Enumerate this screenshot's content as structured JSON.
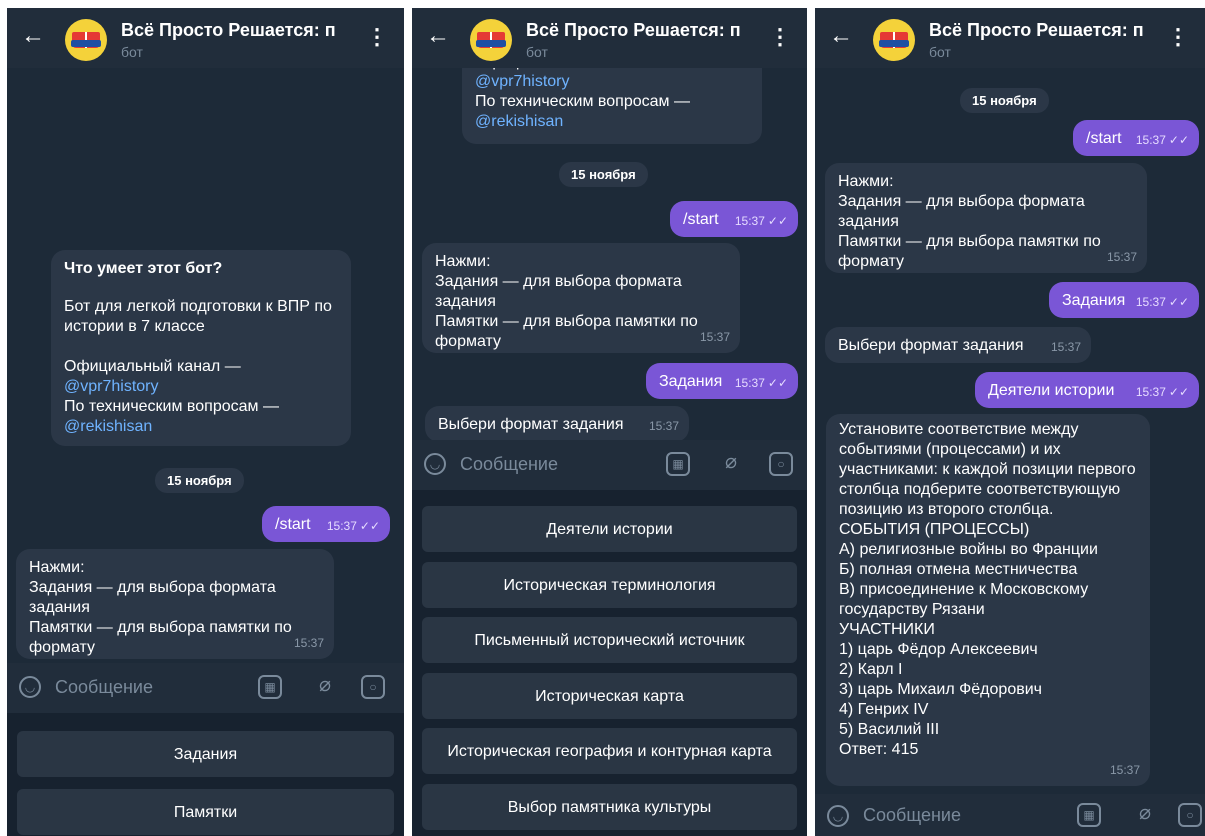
{
  "header": {
    "title": "Всё Просто Решается: п",
    "subtitle": "бот",
    "back_icon": "arrow-left-icon",
    "more_icon": "more-vertical-icon"
  },
  "composer": {
    "placeholder": "Сообщение"
  },
  "date_label": "15 ноября",
  "panel1": {
    "intro_title": "Что умеет этот бот?",
    "intro_text": "Бот для легкой подготовки к ВПР по истории в 7 классе",
    "channel_label": "Официальный канал —",
    "channel_link": "@vpr7history",
    "support_label": "По техническим вопросам —",
    "support_link": "@rekishisan",
    "start_msg": "/start",
    "start_time": "15:37",
    "help_text": "Нажми:\nЗадания — для выбора формата задания\nПамятки — для выбора памятки по формату",
    "help_time": "15:37",
    "keyboard": [
      "Задания",
      "Памятки"
    ]
  },
  "panel2": {
    "top_channel_label": "Официальный канал —",
    "top_channel_link": "@vpr7history",
    "top_support_label": "По техническим вопросам —",
    "top_support_link": "@rekishisan",
    "start_msg": "/start",
    "start_time": "15:37",
    "help_text": "Нажми:\nЗадания — для выбора формата задания\nПамятки — для выбора памятки по формату",
    "help_time": "15:37",
    "tasks_msg": "Задания",
    "tasks_time": "15:37",
    "choose_text": "Выбери формат задания",
    "choose_time": "15:37",
    "keyboard": [
      "Деятели истории",
      "Историческая терминология",
      "Письменный исторический источник",
      "Историческая карта",
      "Историческая география и контурная карта",
      "Выбор памятника культуры"
    ]
  },
  "panel3": {
    "start_msg": "/start",
    "start_time": "15:37",
    "help_text": "Нажми:\nЗадания — для выбора формата задания\nПамятки — для выбора памятки по формату",
    "help_time": "15:37",
    "tasks_msg": "Задания",
    "tasks_time": "15:37",
    "choose_text": "Выбери формат задания",
    "choose_time": "15:37",
    "figures_msg": "Деятели истории",
    "figures_time": "15:37",
    "question_text": "Установите соответствие между событиями (процессами) и их участниками: к каждой позиции первого столбца подберите соответствующую позицию из второго столбца.\nСОБЫТИЯ (ПРОЦЕССЫ)\nА) религиозные войны во Франции\nБ) полная отмена местничества\nВ) присоединение к Московскому государству Рязани\nУЧАСТНИКИ\n1) царь Фёдор Алексеевич\n2) Карл I\n3) царь Михаил Фёдорович\n4) Генрих IV\n5) Василий III\nОтвет: 415",
    "question_time": "15:37"
  },
  "colors": {
    "chat_bg": "#1d2a38",
    "incoming_bubble": "#2b3747",
    "outgoing_bubble": "#7a56d6",
    "link": "#6fb3ff"
  },
  "icons": [
    "emoji-icon",
    "stickers-icon",
    "attach-icon",
    "camera-icon",
    "double-check-icon"
  ]
}
